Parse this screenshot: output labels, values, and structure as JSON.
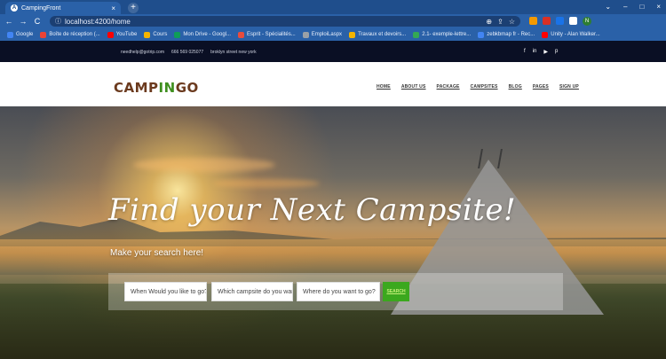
{
  "browser": {
    "tab_title": "CampingFront",
    "tab_close": "×",
    "new_tab": "+",
    "url": "localhost:4200/home",
    "nav": {
      "back": "←",
      "forward": "→",
      "reload": "C"
    },
    "window_controls": [
      "⌄",
      "–",
      "□",
      "×"
    ],
    "bookmarks": [
      {
        "label": "Google",
        "color": "#4285f4"
      },
      {
        "label": "Boîte de réception (...",
        "color": "#ea4335"
      },
      {
        "label": "YouTube",
        "color": "#ff0000"
      },
      {
        "label": "Cours",
        "color": "#f4b400"
      },
      {
        "label": "Mon Drive - Googl...",
        "color": "#0f9d58"
      },
      {
        "label": "Esprit - Spécialités...",
        "color": "#e84c3d"
      },
      {
        "label": "EmploiLaspx",
        "color": "#9aa0a6"
      },
      {
        "label": "Travaux et devoirs...",
        "color": "#f4b400"
      },
      {
        "label": "2.1- exemple-lettre...",
        "color": "#34a853"
      },
      {
        "label": "zebkbmap fr - Rec...",
        "color": "#4285f4"
      },
      {
        "label": "Unity - Alan Walker...",
        "color": "#ff0000"
      }
    ]
  },
  "site": {
    "topbar": {
      "email": "needhelp@gotrip.com",
      "phone": "666 569 025077",
      "address": "broklyn street new york",
      "social": [
        "f",
        "in",
        "▶",
        "p"
      ]
    },
    "logo": {
      "part1": "CAMP",
      "part2": "IN",
      "part3": "GO"
    },
    "menu": [
      "HOME",
      "ABOUT US",
      "PACKAGE",
      "CAMPSITES",
      "BLOG",
      "PAGES",
      "SIGN UP"
    ],
    "hero": {
      "title": "Find your Next Campsite!",
      "subtitle": "Make your search here!",
      "fields": {
        "when": "When Would you like to go?",
        "which": "Which campsite do you want?",
        "where": "Where do you want to go?"
      },
      "search_label": "SEARCH"
    }
  }
}
